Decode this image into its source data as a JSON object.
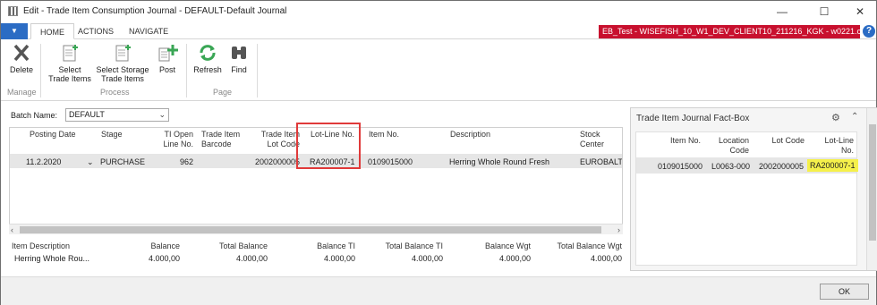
{
  "window": {
    "title": "Edit - Trade Item Consumption Journal - DEFAULT-Default Journal",
    "minimize": "—",
    "maximize": "☐",
    "close": "✕"
  },
  "ribbon_tabs": {
    "app_menu": "▼",
    "tabs": [
      {
        "label": "HOME"
      },
      {
        "label": "ACTIONS"
      },
      {
        "label": "NAVIGATE"
      }
    ],
    "env_badge": "EB_Test - WISEFISH_10_W1_DEV_CLIENT10_211216_KGK - w0221.corp....",
    "help": "?"
  },
  "ribbon": {
    "buttons": [
      {
        "line1": "Delete",
        "line2": "",
        "icon": "delete-icon"
      },
      {
        "line1": "Select",
        "line2": "Trade Items",
        "icon": "select-items-icon"
      },
      {
        "line1": "Select Storage",
        "line2": "Trade Items",
        "icon": "select-storage-icon"
      },
      {
        "line1": "Post",
        "line2": "",
        "icon": "post-icon"
      },
      {
        "line1": "Refresh",
        "line2": "",
        "icon": "refresh-icon"
      },
      {
        "line1": "Find",
        "line2": "",
        "icon": "binoculars-icon"
      }
    ],
    "groups": [
      {
        "label": "Manage"
      },
      {
        "label": "Process"
      },
      {
        "label": "Page"
      }
    ]
  },
  "batch": {
    "label": "Batch Name:",
    "value": "DEFAULT"
  },
  "grid": {
    "columns": [
      {
        "line1": "Posting Date",
        "line2": ""
      },
      {
        "line1": "Stage",
        "line2": ""
      },
      {
        "line1": "TI Open",
        "line2": "Line No."
      },
      {
        "line1": "Trade Item",
        "line2": "Barcode"
      },
      {
        "line1": "Trade Item",
        "line2": "Lot Code"
      },
      {
        "line1": "Lot-Line No.",
        "line2": ""
      },
      {
        "line1": "Item No.",
        "line2": ""
      },
      {
        "line1": "Description",
        "line2": ""
      },
      {
        "line1": "Stock",
        "line2": "Center"
      }
    ],
    "row": {
      "posting_date": "11.2.2020",
      "stage": "PURCHASE",
      "ti_open_line_no": "962",
      "barcode": "",
      "lot_code": "2002000005",
      "lot_line_no": "RA200007-1",
      "item_no": "0109015000",
      "description": "Herring Whole Round Fresh",
      "stock_center": "EUROBALTIC"
    }
  },
  "totals": {
    "headers": [
      "Item Description",
      "Balance",
      "Total Balance",
      "Balance TI",
      "Total Balance TI",
      "Balance Wgt",
      "Total Balance Wgt"
    ],
    "values": [
      "Herring Whole Rou...",
      "4.000,00",
      "4.000,00",
      "4.000,00",
      "4.000,00",
      "4.000,00",
      "4.000,00"
    ]
  },
  "factbox": {
    "title": "Trade Item Journal Fact-Box",
    "columns": [
      {
        "line1": "Item No.",
        "line2": ""
      },
      {
        "line1": "Location",
        "line2": "Code"
      },
      {
        "line1": "Lot Code",
        "line2": ""
      },
      {
        "line1": "Lot-Line",
        "line2": "No."
      }
    ],
    "row": {
      "item_no": "0109015000",
      "location_code": "L0063-000",
      "lot_code": "2002000005",
      "lot_line_no": "RA200007-1"
    }
  },
  "footer": {
    "ok": "OK"
  },
  "colors": {
    "accent": "#2b6cc4",
    "env_badge": "#c8102e",
    "highlight_box": "#e03a3a",
    "highlight_fill": "#f5f04a"
  }
}
